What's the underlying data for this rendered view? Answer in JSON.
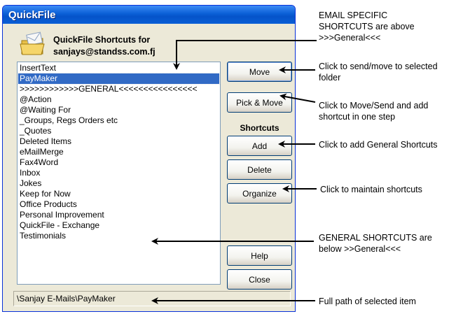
{
  "window": {
    "title": "QuickFile",
    "header_line1": "QuickFile Shortcuts for",
    "header_line2": "sanjays@standss.com.fj",
    "icon": "folder-email-icon"
  },
  "list": {
    "items": [
      "InsertText",
      "PayMaker",
      ">>>>>>>>>>>>GENERAL<<<<<<<<<<<<<<<<",
      "@Action",
      "@Waiting For",
      "_Groups, Regs Orders etc",
      "_Quotes",
      "Deleted Items",
      "eMailMerge",
      "Fax4Word",
      "Inbox",
      "Jokes",
      "Keep for Now",
      "Office Products",
      "Personal Improvement",
      "QuickFile - Exchange",
      "Testimonials"
    ],
    "selected": "PayMaker"
  },
  "buttons": {
    "move": "Move",
    "pick_move": "Pick & Move",
    "shortcuts_label": "Shortcuts",
    "add": "Add",
    "delete": "Delete",
    "organize": "Organize",
    "help": "Help",
    "close": "Close"
  },
  "status_path": "\\Sanjay E-Mails\\PayMaker",
  "annotations": {
    "email_specific_1": "EMAIL SPECIFIC",
    "email_specific_2": "SHORTCUTS are above",
    "email_specific_3": ">>>General<<<",
    "send_move_1": "Click to send/move to selected",
    "send_move_2": "folder",
    "pick_move_1": "Click to Move/Send and add",
    "pick_move_2": "shortcut in one step",
    "add_general": "Click to add General Shortcuts",
    "maintain": "Click to maintain shortcuts",
    "general_1": "GENERAL SHORTCUTS are",
    "general_2": "below >>General<<<",
    "full_path": "Full path of selected item"
  },
  "colors": {
    "titlebar": "#0a5fd6",
    "selection": "#316ac5",
    "dialog_bg": "#ece9d8"
  }
}
